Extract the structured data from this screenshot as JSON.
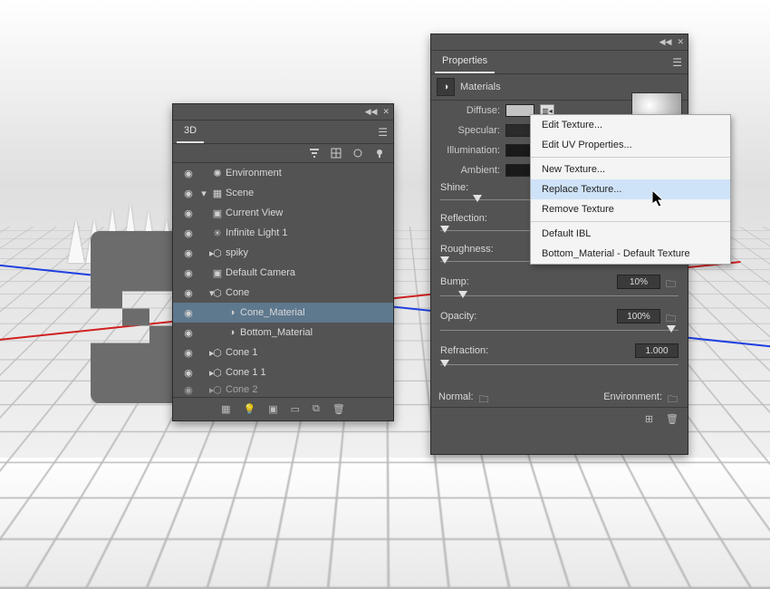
{
  "panel3d": {
    "title": "3D",
    "tree": {
      "environment": "Environment",
      "scene": "Scene",
      "current_view": "Current View",
      "infinite_light": "Infinite Light 1",
      "spiky": "spiky",
      "default_camera": "Default Camera",
      "cone": "Cone",
      "cone_material": "Cone_Material",
      "bottom_material": "Bottom_Material",
      "cone1": "Cone 1",
      "cone11": "Cone 1 1",
      "cone2": "Cone 2"
    }
  },
  "properties": {
    "title": "Properties",
    "section": "Materials",
    "labels": {
      "diffuse": "Diffuse:",
      "specular": "Specular:",
      "illumination": "Illumination:",
      "ambient": "Ambient:",
      "shine": "Shine:",
      "reflection": "Reflection:",
      "roughness": "Roughness:",
      "bump": "Bump:",
      "opacity": "Opacity:",
      "refraction": "Refraction:",
      "normal": "Normal:",
      "environment": "Environment:"
    },
    "swatches": {
      "diffuse": "#c4c4c4",
      "specular": "#2b2b2b",
      "illumination": "#1a1a1a",
      "ambient": "#1a1a1a"
    },
    "values": {
      "bump": "10%",
      "opacity": "100%",
      "refraction": "1.000"
    }
  },
  "context_menu": {
    "items": {
      "edit_texture": "Edit Texture...",
      "edit_uv": "Edit UV Properties...",
      "new_texture": "New Texture...",
      "replace_texture": "Replace Texture...",
      "remove_texture": "Remove Texture",
      "default_ibl": "Default IBL",
      "bottom_default": "Bottom_Material - Default Texture"
    }
  }
}
